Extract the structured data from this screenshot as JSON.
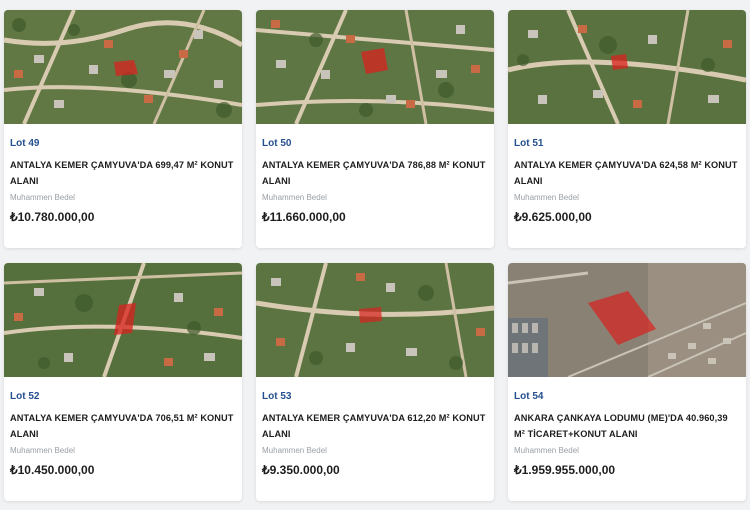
{
  "listings": [
    {
      "lot": "Lot 49",
      "title": "ANTALYA KEMER ÇAMYUVA'DA 699,47 M² KONUT ALANI",
      "label": "Muhammen Bedel",
      "price": "₺10.780.000,00",
      "map": "residential-aerial"
    },
    {
      "lot": "Lot 50",
      "title": "ANTALYA KEMER ÇAMYUVA'DA 786,88 M² KONUT ALANI",
      "label": "Muhammen Bedel",
      "price": "₺11.660.000,00",
      "map": "residential-aerial"
    },
    {
      "lot": "Lot 51",
      "title": "ANTALYA KEMER ÇAMYUVA'DA 624,58 M² KONUT ALANI",
      "label": "Muhammen Bedel",
      "price": "₺9.625.000,00",
      "map": "residential-aerial"
    },
    {
      "lot": "Lot 52",
      "title": "ANTALYA KEMER ÇAMYUVA'DA 706,51 M² KONUT ALANI",
      "label": "Muhammen Bedel",
      "price": "₺10.450.000,00",
      "map": "residential-aerial"
    },
    {
      "lot": "Lot 53",
      "title": "ANTALYA KEMER ÇAMYUVA'DA 612,20 M² KONUT ALANI",
      "label": "Muhammen Bedel",
      "price": "₺9.350.000,00",
      "map": "residential-aerial"
    },
    {
      "lot": "Lot 54",
      "title": "ANKARA ÇANKAYA LODUMU (ME)'DA 40.960,39 M² TİCARET+KONUT ALANI",
      "label": "Muhammen Bedel",
      "price": "₺1.959.955.000,00",
      "map": "urban-barren-aerial"
    }
  ],
  "colors": {
    "lot_accent": "#25508f",
    "parcel_highlight": "#d9211e",
    "background": "#f1f2f4"
  }
}
